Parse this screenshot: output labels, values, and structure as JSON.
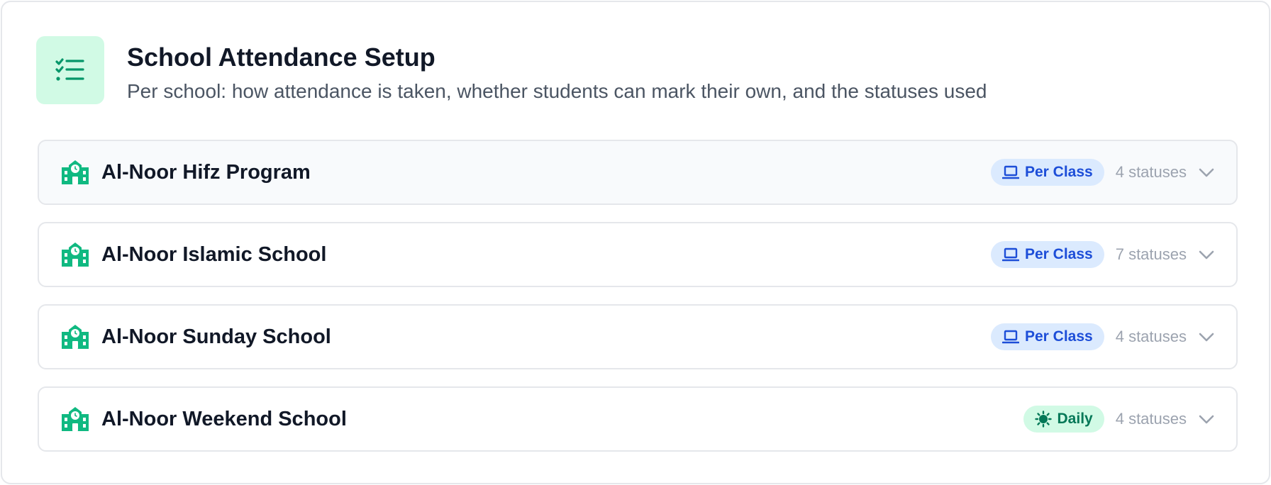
{
  "header": {
    "title": "School Attendance Setup",
    "subtitle": "Per school: how attendance is taken, whether students can mark their own, and the statuses used",
    "icon": "list-checks-icon"
  },
  "colors": {
    "accent_green": "#10b981",
    "per_class_bg": "#dbeafe",
    "per_class_text": "#1d4ed8",
    "daily_bg": "#d1fae5",
    "daily_text": "#047857"
  },
  "schools": [
    {
      "name": "Al-Noor Hifz Program",
      "mode": "Per Class",
      "mode_icon": "laptop-icon",
      "statuses": "4 statuses"
    },
    {
      "name": "Al-Noor Islamic School",
      "mode": "Per Class",
      "mode_icon": "laptop-icon",
      "statuses": "7 statuses"
    },
    {
      "name": "Al-Noor Sunday School",
      "mode": "Per Class",
      "mode_icon": "laptop-icon",
      "statuses": "4 statuses"
    },
    {
      "name": "Al-Noor Weekend School",
      "mode": "Daily",
      "mode_icon": "sun-icon",
      "statuses": "4 statuses"
    }
  ]
}
